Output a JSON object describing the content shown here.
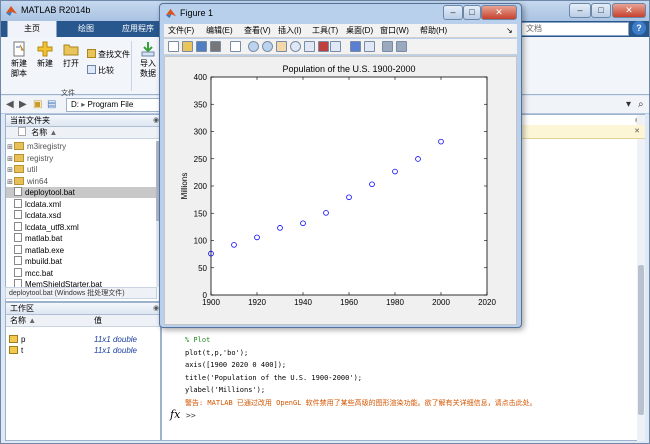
{
  "matlab": {
    "title": "MATLAB R2014b",
    "tabs": [
      "主页",
      "绘图",
      "应用程序"
    ],
    "search_placeholder": "文档",
    "ribbon": {
      "new_script": "新建\n脚本",
      "new": "新建",
      "open": "打开",
      "find_files": "查找文件",
      "compare": "比较",
      "import": "导入\n数据",
      "group_label": "文件"
    },
    "address": {
      "drive": "D:",
      "crumb": "Program File"
    },
    "current_folder": {
      "header": "当前文件夹",
      "col_name": "名称",
      "items": [
        {
          "name": "m3iregistry",
          "type": "folder",
          "expandable": true
        },
        {
          "name": "registry",
          "type": "folder",
          "expandable": true
        },
        {
          "name": "util",
          "type": "folder",
          "expandable": true
        },
        {
          "name": "win64",
          "type": "folder",
          "expandable": true
        },
        {
          "name": "deploytool.bat",
          "type": "file",
          "selected": true
        },
        {
          "name": "lcdata.xml",
          "type": "file"
        },
        {
          "name": "lcdata.xsd",
          "type": "file"
        },
        {
          "name": "lcdata_utf8.xml",
          "type": "file"
        },
        {
          "name": "matlab.bat",
          "type": "file"
        },
        {
          "name": "matlab.exe",
          "type": "file"
        },
        {
          "name": "mbuild.bat",
          "type": "file"
        },
        {
          "name": "mcc.bat",
          "type": "file"
        },
        {
          "name": "MemShieldStarter.bat",
          "type": "file"
        }
      ],
      "status": "deploytool.bat (Windows 批处理文件)"
    },
    "workspace": {
      "header": "工作区",
      "col_name": "名称",
      "col_value": "值",
      "vars": [
        {
          "name": "p",
          "value": "11x1 double"
        },
        {
          "name": "t",
          "value": "11x1 double"
        }
      ]
    },
    "command_window": {
      "lines": [
        {
          "text": "% Plot",
          "kind": "comment"
        },
        {
          "text": "plot(t,p,'bo');",
          "kind": "code"
        },
        {
          "text": "axis([1900 2020 0 400]);",
          "kind": "code"
        },
        {
          "text": "title('Population of the U.S. 1900-2000');",
          "kind": "code"
        },
        {
          "text": "ylabel('Millions');",
          "kind": "code"
        },
        {
          "text": "警告: MATLAB 已通过改用 OpenGL 软件禁用了某些高级的图形渲染功能。欲了解有关详细信息，请点击此处。",
          "kind": "warning"
        }
      ],
      "prompt_symbol": "fx",
      "caret": ">>"
    }
  },
  "figure": {
    "title": "Figure 1",
    "menus": [
      "文件(F)",
      "编辑(E)",
      "查看(V)",
      "插入(I)",
      "工具(T)",
      "桌面(D)",
      "窗口(W)",
      "帮助(H)"
    ],
    "icons": [
      "new-figure-icon",
      "open-icon",
      "save-icon",
      "print-icon",
      "arrow-icon",
      "zoom-in-icon",
      "zoom-out-icon",
      "pan-icon",
      "rotate-icon",
      "data-cursor-icon",
      "brush-icon",
      "link-icon",
      "colorbar-icon",
      "legend-icon",
      "hide-plot-tools-icon",
      "show-plot-tools-icon"
    ]
  },
  "chart_data": {
    "type": "scatter",
    "title": "Population of the U.S. 1900-2000",
    "xlabel": "",
    "ylabel": "Millions",
    "xlim": [
      1900,
      2020
    ],
    "ylim": [
      0,
      400
    ],
    "xticks": [
      1900,
      1920,
      1940,
      1960,
      1980,
      2000,
      2020
    ],
    "yticks": [
      0,
      50,
      100,
      150,
      200,
      250,
      300,
      350,
      400
    ],
    "marker": "o",
    "color": "#0000ff",
    "x": [
      1900,
      1910,
      1920,
      1930,
      1940,
      1950,
      1960,
      1970,
      1980,
      1990,
      2000
    ],
    "y": [
      75.995,
      91.972,
      105.711,
      123.203,
      131.669,
      150.697,
      179.323,
      203.212,
      226.505,
      249.633,
      281.422
    ]
  }
}
